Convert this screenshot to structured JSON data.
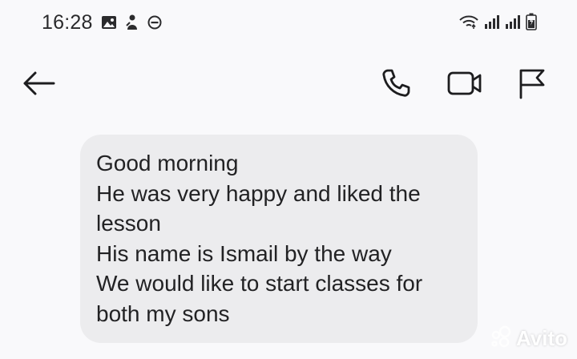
{
  "status_bar": {
    "time": "16:28",
    "left_icons": [
      "gallery-icon",
      "person-icon",
      "do-not-disturb-icon"
    ],
    "right_icons": [
      "wifi-icon",
      "signal-icon",
      "signal-icon",
      "battery-icon"
    ]
  },
  "toolbar": {
    "back_icon": "back-arrow-icon",
    "actions": [
      "phone-icon",
      "video-camera-icon",
      "flag-icon"
    ]
  },
  "message": {
    "lines": [
      "Good morning",
      "He was very happy and liked the",
      "lesson",
      "His name is Ismail by the way",
      "We would like to start classes for",
      "both my sons"
    ]
  },
  "watermark": {
    "text": "Avito"
  },
  "colors": {
    "background": "#f9f9fb",
    "bubble": "#ececee",
    "text": "#222224"
  }
}
